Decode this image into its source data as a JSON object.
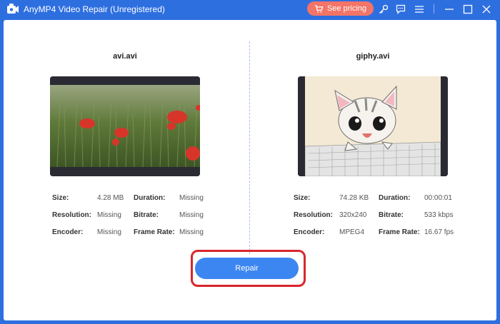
{
  "window": {
    "title": "AnyMP4 Video Repair (Unregistered)",
    "pricing_label": "See pricing",
    "icons": [
      "app-logo-icon",
      "cart-icon",
      "key-icon",
      "feedback-icon",
      "menu-icon",
      "minimize-icon",
      "maximize-icon",
      "close-icon"
    ]
  },
  "left": {
    "filename": "avi.avi",
    "labels": {
      "size": "Size:",
      "duration": "Duration:",
      "resolution": "Resolution:",
      "bitrate": "Bitrate:",
      "encoder": "Encoder:",
      "frame_rate": "Frame Rate:"
    },
    "values": {
      "size": "4.28 MB",
      "duration": "Missing",
      "resolution": "Missing",
      "bitrate": "Missing",
      "encoder": "Missing",
      "frame_rate": "Missing"
    }
  },
  "right": {
    "filename": "giphy.avi",
    "labels": {
      "size": "Size:",
      "duration": "Duration:",
      "resolution": "Resolution:",
      "bitrate": "Bitrate:",
      "encoder": "Encoder:",
      "frame_rate": "Frame Rate:"
    },
    "values": {
      "size": "74.28 KB",
      "duration": "00:00:01",
      "resolution": "320x240",
      "bitrate": "533 kbps",
      "encoder": "MPEG4",
      "frame_rate": "16.67 fps"
    }
  },
  "actions": {
    "repair_label": "Repair"
  },
  "colors": {
    "titlebar": "#2e6fe0",
    "pricing": "#f47468",
    "repair": "#3c86f2",
    "highlight": "#d9262c"
  }
}
